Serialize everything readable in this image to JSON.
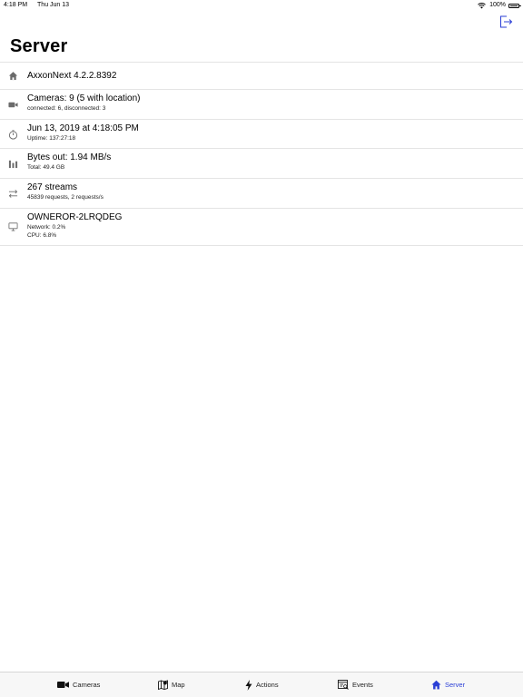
{
  "status_bar": {
    "time": "4:18 PM",
    "date": "Thu Jun 13",
    "battery": "100%"
  },
  "header": {
    "title": "Server",
    "logout_icon": "logout-icon"
  },
  "items": [
    {
      "icon": "home-icon",
      "primary": "AxxonNext 4.2.2.8392",
      "secondary": []
    },
    {
      "icon": "camera-icon",
      "primary": "Cameras: 9 (5 with location)",
      "secondary": [
        "connected: 6, disconnected: 3"
      ]
    },
    {
      "icon": "clock-icon",
      "primary": "Jun 13, 2019 at 4:18:05 PM",
      "secondary": [
        "Uptime: 137:27:18"
      ]
    },
    {
      "icon": "bar-chart-icon",
      "primary": "Bytes out: 1.94 MB/s",
      "secondary": [
        "Total: 49.4 GB"
      ]
    },
    {
      "icon": "transfer-arrows-icon",
      "primary": "267 streams",
      "secondary": [
        "45839 requests, 2 requests/s"
      ]
    },
    {
      "icon": "monitor-icon",
      "primary": "OWNEROR-2LRQDEG",
      "secondary": [
        "Network: 0.2%",
        "CPU: 6.8%"
      ]
    }
  ],
  "tabs": [
    {
      "label": "Cameras",
      "icon": "camera-icon",
      "active": false
    },
    {
      "label": "Map",
      "icon": "map-icon",
      "active": false
    },
    {
      "label": "Actions",
      "icon": "lightning-icon",
      "active": false
    },
    {
      "label": "Events",
      "icon": "events-icon",
      "active": false
    },
    {
      "label": "Server",
      "icon": "home-icon",
      "active": true
    }
  ],
  "colors": {
    "accent": "#2b3fd6",
    "icon_gray": "#6b6b6b",
    "separator": "#e4e4e4"
  }
}
